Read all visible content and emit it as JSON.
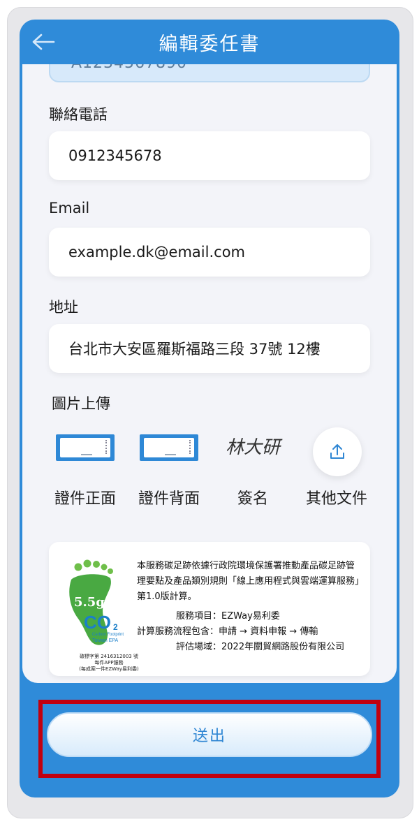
{
  "header": {
    "title": "編輯委任書",
    "back_icon": "arrow-left-icon"
  },
  "form": {
    "phone": {
      "label": "聯絡電話",
      "value": "0912345678"
    },
    "email": {
      "label": "Email",
      "value": "example.dk@email.com"
    },
    "address": {
      "label": "地址",
      "value": "台北市大安區羅斯福路三段 37號 12樓"
    }
  },
  "upload": {
    "title": "圖片上傳",
    "items": [
      {
        "caption": "證件正面",
        "icon": "id-card-front-thumbnail"
      },
      {
        "caption": "證件背面",
        "icon": "id-card-back-thumbnail"
      },
      {
        "caption": "簽名",
        "signature_text": "林大研"
      },
      {
        "caption": "其他文件",
        "icon": "upload-icon"
      }
    ]
  },
  "carbon": {
    "badge_value": "5.5g",
    "co2": "CO",
    "co2_sub": "2",
    "label_en_1": "Carbon Footprint",
    "label_en_2": "Taiwan EPA",
    "badge_caption_1": "碳標字第 2416312003 號",
    "badge_caption_2": "每件APP服務",
    "badge_caption_3": "(每成案一件EZWay易利委)",
    "text_1": "本服務碳足跡依據行政院環境保護署推動產品碳足跡管理要點及產品類別規則「線上應用程式與雲端運算服務」第1.0版計算。",
    "service": "服務項目：EZWay易利委",
    "process": "計算服務流程包含：申請 → 資料申報 → 傳輸",
    "site": "評估場域：2022年關貿網路股份有限公司"
  },
  "submit": {
    "label": "送出"
  },
  "colors": {
    "primary": "#2f8bd9",
    "highlight_border": "#c1000f",
    "card_bg": "#f3f4f9",
    "badge_green": "#49a942"
  }
}
